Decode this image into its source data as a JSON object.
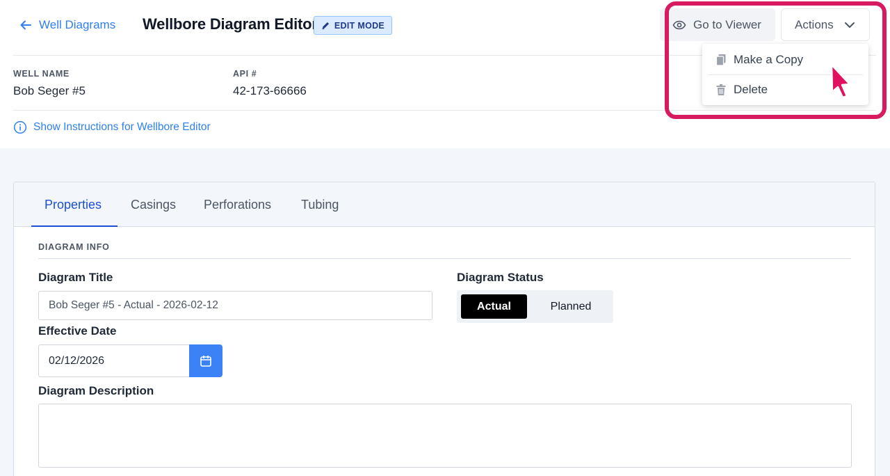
{
  "header": {
    "back_label": "Well Diagrams",
    "title": "Wellbore Diagram Editor",
    "mode_badge": "EDIT MODE",
    "viewer_label": "Go to Viewer",
    "actions_label": "Actions"
  },
  "actions_menu": {
    "items": [
      {
        "label": "Make a Copy",
        "icon": "copy-icon"
      },
      {
        "label": "Delete",
        "icon": "trash-icon"
      }
    ]
  },
  "well": {
    "name_label": "WELL NAME",
    "name_value": "Bob Seger #5",
    "api_label": "API #",
    "api_value": "42-173-66666"
  },
  "instructions_link": "Show Instructions for Wellbore Editor",
  "tabs": [
    {
      "label": "Properties",
      "active": true
    },
    {
      "label": "Casings",
      "active": false
    },
    {
      "label": "Perforations",
      "active": false
    },
    {
      "label": "Tubing",
      "active": false
    }
  ],
  "properties": {
    "section_label": "DIAGRAM INFO",
    "title_label": "Diagram Title",
    "title_value": "Bob Seger #5 - Actual - 2026-02-12",
    "status_label": "Diagram Status",
    "status_options": [
      "Actual",
      "Planned"
    ],
    "status_selected": "Actual",
    "date_label": "Effective Date",
    "date_value": "02/12/2026",
    "description_label": "Diagram Description",
    "description_value": ""
  },
  "colors": {
    "link": "#2f80ed",
    "active_tab": "#1d4ed8",
    "date_button": "#3b82f6",
    "highlight": "#d81b60"
  }
}
